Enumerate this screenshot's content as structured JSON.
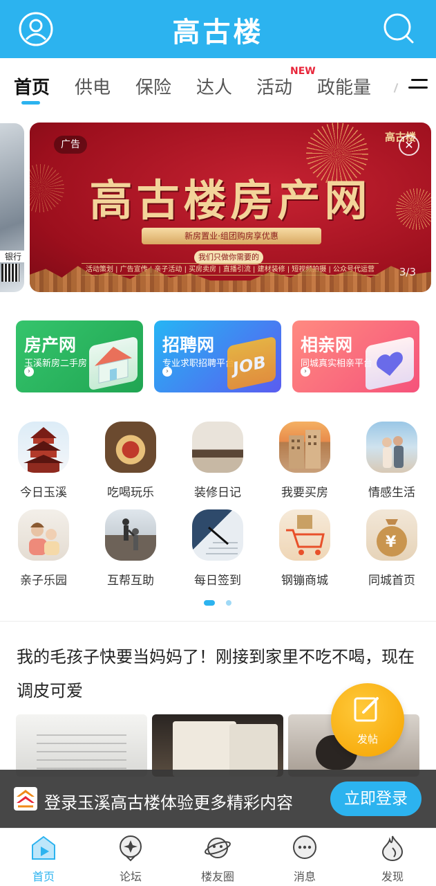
{
  "app": {
    "title": "高古楼"
  },
  "colors": {
    "brand": "#2cb3ef",
    "fab": "#f5a300",
    "accent_red": "#e8263a"
  },
  "header": {
    "left_icon": "user-avatar-icon",
    "right_icon": "search-icon"
  },
  "tabs": {
    "items": [
      {
        "label": "首页",
        "active": true
      },
      {
        "label": "供电",
        "active": false
      },
      {
        "label": "保险",
        "active": false
      },
      {
        "label": "达人",
        "active": false
      },
      {
        "label": "活动",
        "active": false
      },
      {
        "label": "政能量",
        "active": false
      }
    ],
    "new_badge": "NEW",
    "menu_icon": "menu-lines-icon"
  },
  "banner": {
    "ad_label": "广告",
    "brand": "高古楼",
    "headline": "高古楼房产网",
    "ribbon": "新房置业·组团购房享优惠",
    "slogan": "我们只做你需要的",
    "services": "活动策划 | 广告宣传 | 亲子活动 | 买房卖房 | 直播引流 | 建材装修 | 短视频拍摄 | 公众号代运营",
    "counter": "3/3",
    "prev_text": "银行"
  },
  "cards": [
    {
      "title": "房产网",
      "subtitle": "玉溪新房二手房",
      "color_from": "#35c46c",
      "color_to": "#20a552"
    },
    {
      "title": "招聘网",
      "subtitle": "专业求职招聘平台",
      "color_from": "#26b5f4",
      "color_to": "#5a5cf0"
    },
    {
      "title": "相亲网",
      "subtitle": "同城真实相亲平台",
      "color_from": "#ff8a80",
      "color_to": "#f5537b"
    }
  ],
  "grid": [
    {
      "label": "今日玉溪",
      "icon": "pagoda-icon"
    },
    {
      "label": "吃喝玩乐",
      "icon": "food-icon"
    },
    {
      "label": "装修日记",
      "icon": "living-room-icon"
    },
    {
      "label": "我要买房",
      "icon": "building-icon"
    },
    {
      "label": "情感生活",
      "icon": "couple-icon"
    },
    {
      "label": "亲子乐园",
      "icon": "family-icon"
    },
    {
      "label": "互帮互助",
      "icon": "helping-hand-icon"
    },
    {
      "label": "每日签到",
      "icon": "signing-icon"
    },
    {
      "label": "钢镚商城",
      "icon": "shopping-cart-icon"
    },
    {
      "label": "同城首页",
      "icon": "money-bag-icon"
    }
  ],
  "post": {
    "title": "我的毛孩子快要当妈妈了！刚接到家里不吃不喝，现在调皮可爱"
  },
  "fab": {
    "label": "发帖",
    "icon": "edit-icon"
  },
  "login_bar": {
    "text": "登录玉溪高古楼体验更多精彩内容",
    "button": "立即登录"
  },
  "bottom_nav": [
    {
      "label": "首页",
      "icon": "home-play-icon",
      "active": true
    },
    {
      "label": "论坛",
      "icon": "forum-icon",
      "active": false
    },
    {
      "label": "楼友圈",
      "icon": "planet-icon",
      "active": false
    },
    {
      "label": "消息",
      "icon": "message-icon",
      "active": false
    },
    {
      "label": "发现",
      "icon": "discover-flame-icon",
      "active": false
    }
  ]
}
